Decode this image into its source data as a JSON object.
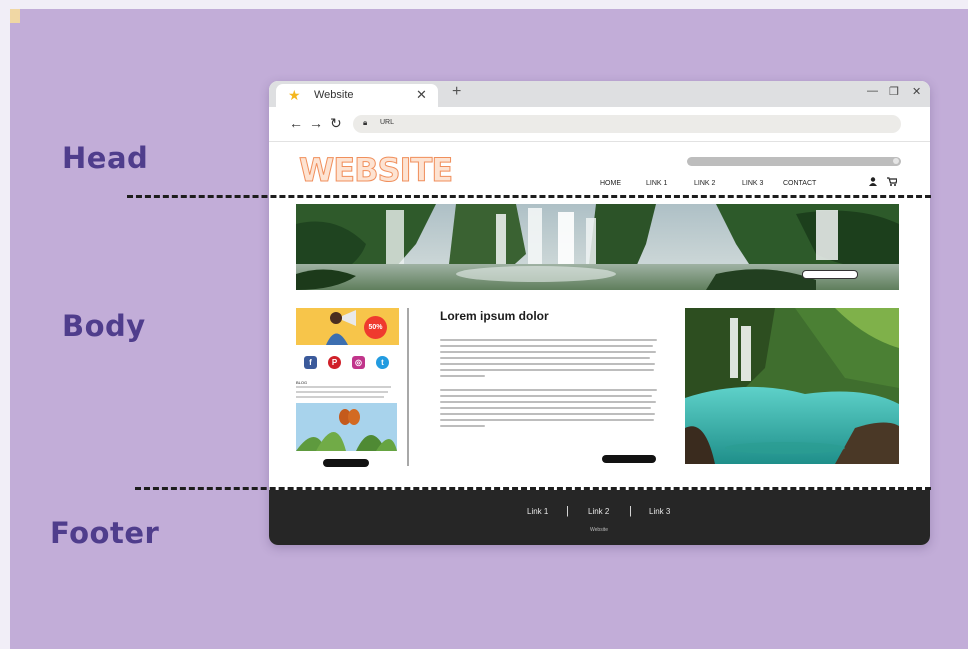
{
  "labels": {
    "head": "Head",
    "body": "Body",
    "footer": "Footer"
  },
  "browser": {
    "tab_title": "Website",
    "tab_close": "✕",
    "new_tab": "+",
    "url_text": "URL",
    "win_min": "—",
    "win_restore": "❐",
    "win_close": "✕"
  },
  "site": {
    "logo": "WEBSITE",
    "nav": [
      "HOME",
      "LINK 1",
      "LINK 2",
      "LINK 3",
      "CONTACT"
    ],
    "article_title": "Lorem ipsum dolor",
    "promo_badge": "50%",
    "blog_title": "BLOG",
    "footer_links": [
      "Link 1",
      "Link 2",
      "Link 3"
    ],
    "footer_site": "Website"
  },
  "colors": {
    "slide_bg": "#c2add8",
    "label": "#4f3d8c",
    "footer_bg": "#262626",
    "logo_fill": "#fde3d2",
    "logo_stroke": "#f08f5c",
    "star": "#f4b61d"
  },
  "icons": [
    "star-icon",
    "close-icon",
    "plus-icon",
    "back-arrow-icon",
    "forward-arrow-icon",
    "reload-icon",
    "lock-icon",
    "user-icon",
    "cart-icon",
    "facebook-icon",
    "pinterest-icon",
    "instagram-icon",
    "twitter-icon"
  ]
}
